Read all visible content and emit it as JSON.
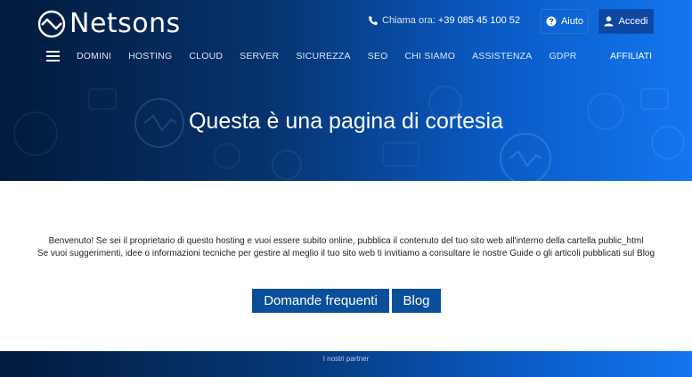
{
  "brand": {
    "name": "Netsons"
  },
  "header": {
    "phone_label": "Chiama ora:",
    "phone_number": "+39 085 45 100 52",
    "help_label": "Aiuto",
    "login_label": "Accedi"
  },
  "nav": {
    "items": [
      {
        "label": "DOMINI"
      },
      {
        "label": "HOSTING"
      },
      {
        "label": "CLOUD"
      },
      {
        "label": "SERVER"
      },
      {
        "label": "SICUREZZA"
      },
      {
        "label": "SEO"
      },
      {
        "label": "CHI SIAMO"
      },
      {
        "label": "ASSISTENZA"
      },
      {
        "label": "GDPR"
      }
    ],
    "affiliates": "AFFILIATI"
  },
  "hero": {
    "title": "Questa è una pagina di cortesia"
  },
  "content": {
    "line1": "Benvenuto! Se sei il proprietario di questo hosting e vuoi essere subito online, pubblica il contenuto del tuo sito web all'interno della cartella public_html",
    "line2": "Se vuoi suggerimenti, idee o informazioni tecniche per gestire al meglio il tuo sito web ti invitiamo a consultare le nostre Guide o gli articoli pubblicati sul Blog",
    "faq_button": "Domande frequenti",
    "blog_button": "Blog"
  },
  "footer": {
    "partners": "I nostri partner"
  },
  "colors": {
    "hero_dark": "#021a3c",
    "hero_light": "#1376f0",
    "button_blue": "#0a4f9a",
    "login_blue": "#0d47a1"
  }
}
